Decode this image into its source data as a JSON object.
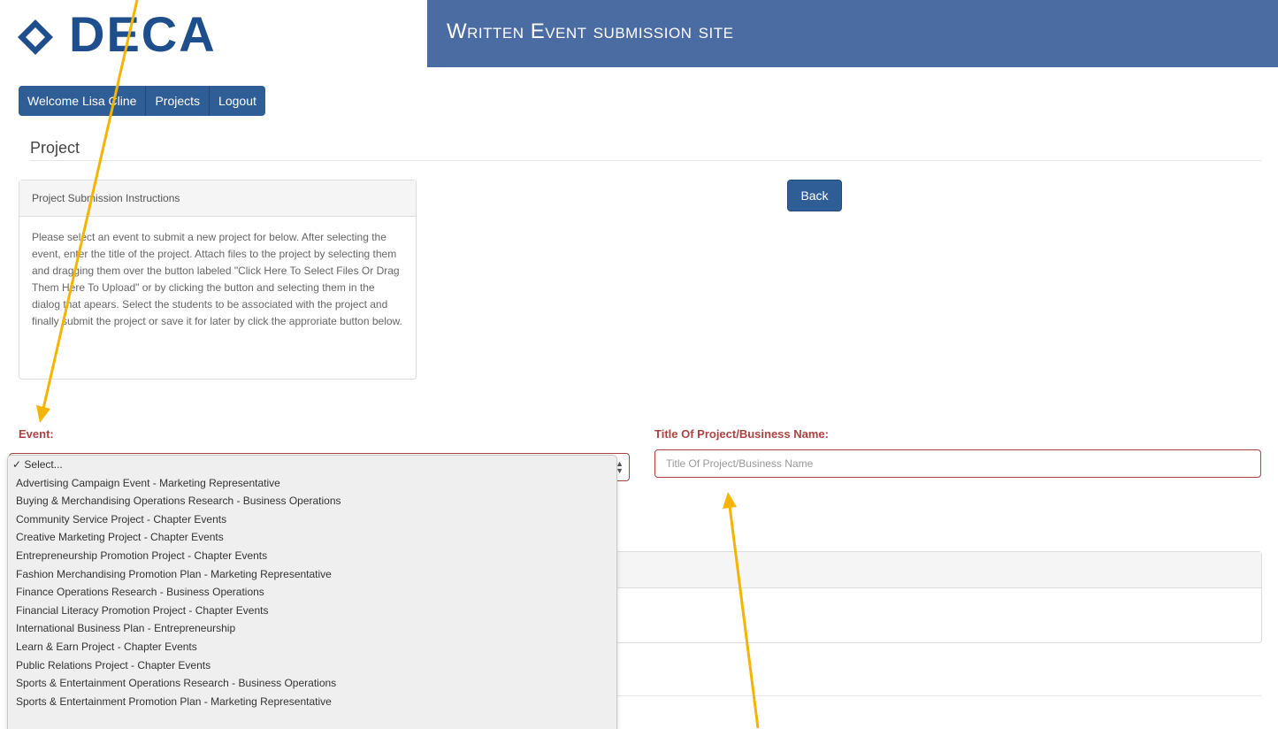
{
  "header": {
    "logo_text": "DECA",
    "site_title": "Written Event submission site",
    "brand_color": "#1f4e8c",
    "banner_color": "#4a6ca3"
  },
  "nav": {
    "welcome": "Welcome Lisa Cline",
    "projects": "Projects",
    "logout": "Logout"
  },
  "page": {
    "heading": "Project"
  },
  "instructions": {
    "title": "Project Submission Instructions",
    "body": "Please select an event to submit a new project for below. After selecting the event, enter the title of the project. Attach files to the project by selecting them and dragging them over the button labeled \"Click Here To Select Files Or Drag Them Here To Upload\" or by clicking the button and selecting them in the dialog that apears. Select the students to be associated with the project and finally submit the project or save it for later by click the approriate button below."
  },
  "back_button": "Back",
  "form": {
    "event_label": "Event:",
    "title_label": "Title Of Project/Business Name:",
    "title_placeholder": "Title Of Project/Business Name",
    "event_options": [
      "Select...",
      "Advertising Campaign Event - Marketing Representative",
      "Buying & Merchandising Operations Research - Business Operations",
      "Community Service Project - Chapter Events",
      "Creative Marketing Project - Chapter Events",
      "Entrepreneurship Promotion Project - Chapter Events",
      "Fashion Merchandising Promotion Plan - Marketing Representative",
      "Finance Operations Research - Business Operations",
      "Financial Literacy Promotion Project - Chapter Events",
      "International Business Plan - Entrepreneurship",
      "Learn & Earn Project - Chapter Events",
      "Public Relations Project - Chapter Events",
      "Sports & Entertainment Operations Research - Business Operations",
      "Sports & Entertainment Promotion Plan - Marketing Representative"
    ],
    "selected_check": "✓",
    "error_color": "#a94442"
  },
  "annotation": {
    "arrow_color": "#f5b400"
  }
}
